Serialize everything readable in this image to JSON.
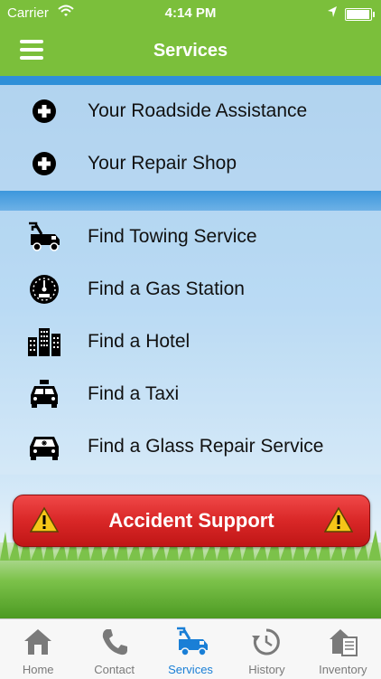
{
  "status": {
    "carrier": "Carrier",
    "time": "4:14 PM",
    "battery_level": 0.95
  },
  "header": {
    "title": "Services"
  },
  "my_services": [
    {
      "label": "Your Roadside Assistance",
      "icon": "plus-circle-icon"
    },
    {
      "label": "Your Repair Shop",
      "icon": "plus-circle-icon"
    }
  ],
  "find_services": [
    {
      "label": "Find Towing Service",
      "icon": "tow-truck-icon"
    },
    {
      "label": "Find a Gas Station",
      "icon": "gauge-icon"
    },
    {
      "label": "Find a Hotel",
      "icon": "buildings-icon"
    },
    {
      "label": "Find a Taxi",
      "icon": "taxi-icon"
    },
    {
      "label": "Find a Glass Repair Service",
      "icon": "car-glass-icon"
    }
  ],
  "accident": {
    "label": "Accident Support",
    "icon": "warning-icon"
  },
  "tabs": [
    {
      "label": "Home",
      "icon": "house-icon"
    },
    {
      "label": "Contact",
      "icon": "phone-icon"
    },
    {
      "label": "Services",
      "icon": "tow-truck-icon",
      "active": true
    },
    {
      "label": "History",
      "icon": "history-icon"
    },
    {
      "label": "Inventory",
      "icon": "inventory-icon"
    }
  ],
  "colors": {
    "header_green": "#7bbf3b",
    "band_blue": "#2f8fd8",
    "accident_red": "#d92727",
    "active_tab_blue": "#1a7fd6"
  }
}
